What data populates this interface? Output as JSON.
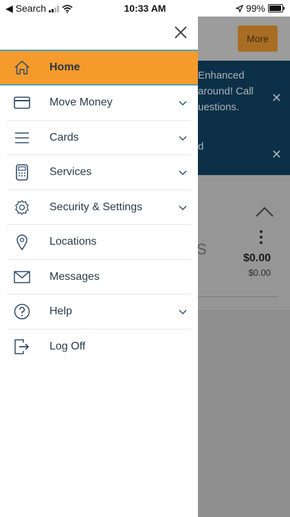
{
  "status_bar": {
    "back_label": "◀ Search",
    "time": "10:33 AM",
    "battery": "99%"
  },
  "drawer": {
    "items": [
      {
        "label": "Home",
        "icon": "home-icon",
        "active": true,
        "expandable": false
      },
      {
        "label": "Move Money",
        "icon": "card-icon",
        "active": false,
        "expandable": true
      },
      {
        "label": "Cards",
        "icon": "menu-lines-icon",
        "active": false,
        "expandable": true
      },
      {
        "label": "Services",
        "icon": "calculator-icon",
        "active": false,
        "expandable": true
      },
      {
        "label": "Security & Settings",
        "icon": "gear-icon",
        "active": false,
        "expandable": true
      },
      {
        "label": "Locations",
        "icon": "location-pin-icon",
        "active": false,
        "expandable": false
      },
      {
        "label": "Messages",
        "icon": "envelope-icon",
        "active": false,
        "expandable": false
      },
      {
        "label": "Help",
        "icon": "help-icon",
        "active": false,
        "expandable": true
      },
      {
        "label": "Log Off",
        "icon": "logout-icon",
        "active": false,
        "expandable": false
      }
    ]
  },
  "background": {
    "more_button": "More",
    "banner_text_1": "Enhanced\naround! Call\nuestions.",
    "banner_text_2": "d",
    "account_fragment": "S",
    "balance": "$0.00",
    "available": "$0.00"
  },
  "colors": {
    "accent": "#f59b2c",
    "accent_border": "#4aa1c7",
    "icon": "#2f4a63"
  }
}
